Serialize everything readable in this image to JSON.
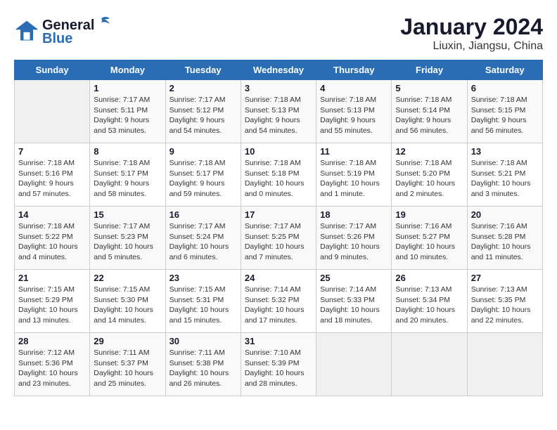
{
  "header": {
    "logo_line1": "General",
    "logo_line2": "Blue",
    "title": "January 2024",
    "subtitle": "Liuxin, Jiangsu, China"
  },
  "weekdays": [
    "Sunday",
    "Monday",
    "Tuesday",
    "Wednesday",
    "Thursday",
    "Friday",
    "Saturday"
  ],
  "weeks": [
    [
      {
        "day": "",
        "info": ""
      },
      {
        "day": "1",
        "info": "Sunrise: 7:17 AM\nSunset: 5:11 PM\nDaylight: 9 hours\nand 53 minutes."
      },
      {
        "day": "2",
        "info": "Sunrise: 7:17 AM\nSunset: 5:12 PM\nDaylight: 9 hours\nand 54 minutes."
      },
      {
        "day": "3",
        "info": "Sunrise: 7:18 AM\nSunset: 5:13 PM\nDaylight: 9 hours\nand 54 minutes."
      },
      {
        "day": "4",
        "info": "Sunrise: 7:18 AM\nSunset: 5:13 PM\nDaylight: 9 hours\nand 55 minutes."
      },
      {
        "day": "5",
        "info": "Sunrise: 7:18 AM\nSunset: 5:14 PM\nDaylight: 9 hours\nand 56 minutes."
      },
      {
        "day": "6",
        "info": "Sunrise: 7:18 AM\nSunset: 5:15 PM\nDaylight: 9 hours\nand 56 minutes."
      }
    ],
    [
      {
        "day": "7",
        "info": "Sunrise: 7:18 AM\nSunset: 5:16 PM\nDaylight: 9 hours\nand 57 minutes."
      },
      {
        "day": "8",
        "info": "Sunrise: 7:18 AM\nSunset: 5:17 PM\nDaylight: 9 hours\nand 58 minutes."
      },
      {
        "day": "9",
        "info": "Sunrise: 7:18 AM\nSunset: 5:17 PM\nDaylight: 9 hours\nand 59 minutes."
      },
      {
        "day": "10",
        "info": "Sunrise: 7:18 AM\nSunset: 5:18 PM\nDaylight: 10 hours\nand 0 minutes."
      },
      {
        "day": "11",
        "info": "Sunrise: 7:18 AM\nSunset: 5:19 PM\nDaylight: 10 hours\nand 1 minute."
      },
      {
        "day": "12",
        "info": "Sunrise: 7:18 AM\nSunset: 5:20 PM\nDaylight: 10 hours\nand 2 minutes."
      },
      {
        "day": "13",
        "info": "Sunrise: 7:18 AM\nSunset: 5:21 PM\nDaylight: 10 hours\nand 3 minutes."
      }
    ],
    [
      {
        "day": "14",
        "info": "Sunrise: 7:18 AM\nSunset: 5:22 PM\nDaylight: 10 hours\nand 4 minutes."
      },
      {
        "day": "15",
        "info": "Sunrise: 7:17 AM\nSunset: 5:23 PM\nDaylight: 10 hours\nand 5 minutes."
      },
      {
        "day": "16",
        "info": "Sunrise: 7:17 AM\nSunset: 5:24 PM\nDaylight: 10 hours\nand 6 minutes."
      },
      {
        "day": "17",
        "info": "Sunrise: 7:17 AM\nSunset: 5:25 PM\nDaylight: 10 hours\nand 7 minutes."
      },
      {
        "day": "18",
        "info": "Sunrise: 7:17 AM\nSunset: 5:26 PM\nDaylight: 10 hours\nand 9 minutes."
      },
      {
        "day": "19",
        "info": "Sunrise: 7:16 AM\nSunset: 5:27 PM\nDaylight: 10 hours\nand 10 minutes."
      },
      {
        "day": "20",
        "info": "Sunrise: 7:16 AM\nSunset: 5:28 PM\nDaylight: 10 hours\nand 11 minutes."
      }
    ],
    [
      {
        "day": "21",
        "info": "Sunrise: 7:15 AM\nSunset: 5:29 PM\nDaylight: 10 hours\nand 13 minutes."
      },
      {
        "day": "22",
        "info": "Sunrise: 7:15 AM\nSunset: 5:30 PM\nDaylight: 10 hours\nand 14 minutes."
      },
      {
        "day": "23",
        "info": "Sunrise: 7:15 AM\nSunset: 5:31 PM\nDaylight: 10 hours\nand 15 minutes."
      },
      {
        "day": "24",
        "info": "Sunrise: 7:14 AM\nSunset: 5:32 PM\nDaylight: 10 hours\nand 17 minutes."
      },
      {
        "day": "25",
        "info": "Sunrise: 7:14 AM\nSunset: 5:33 PM\nDaylight: 10 hours\nand 18 minutes."
      },
      {
        "day": "26",
        "info": "Sunrise: 7:13 AM\nSunset: 5:34 PM\nDaylight: 10 hours\nand 20 minutes."
      },
      {
        "day": "27",
        "info": "Sunrise: 7:13 AM\nSunset: 5:35 PM\nDaylight: 10 hours\nand 22 minutes."
      }
    ],
    [
      {
        "day": "28",
        "info": "Sunrise: 7:12 AM\nSunset: 5:36 PM\nDaylight: 10 hours\nand 23 minutes."
      },
      {
        "day": "29",
        "info": "Sunrise: 7:11 AM\nSunset: 5:37 PM\nDaylight: 10 hours\nand 25 minutes."
      },
      {
        "day": "30",
        "info": "Sunrise: 7:11 AM\nSunset: 5:38 PM\nDaylight: 10 hours\nand 26 minutes."
      },
      {
        "day": "31",
        "info": "Sunrise: 7:10 AM\nSunset: 5:39 PM\nDaylight: 10 hours\nand 28 minutes."
      },
      {
        "day": "",
        "info": ""
      },
      {
        "day": "",
        "info": ""
      },
      {
        "day": "",
        "info": ""
      }
    ]
  ]
}
